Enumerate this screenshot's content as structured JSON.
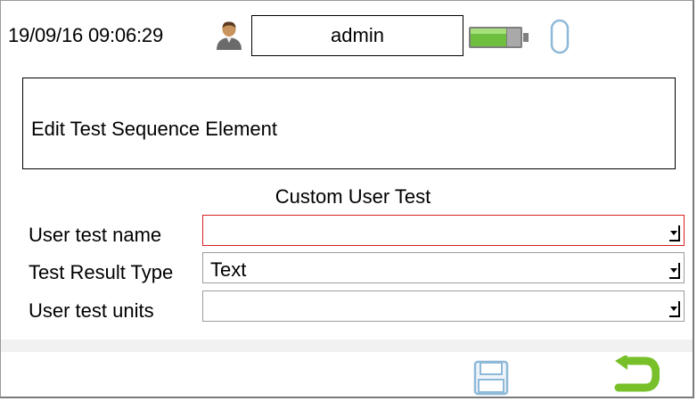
{
  "status_bar": {
    "datetime": "19/09/16 09:06:29",
    "user": "admin",
    "icons": [
      "user-icon",
      "battery-icon",
      "usb-icon"
    ]
  },
  "header": {
    "title": "Edit Test Sequence Element"
  },
  "form": {
    "section_title": "Custom User Test",
    "fields": [
      {
        "label": "User test name",
        "value": "",
        "error": true
      },
      {
        "label": "Test Result Type",
        "value": "Text",
        "error": false
      },
      {
        "label": "User test units",
        "value": "",
        "error": false
      }
    ]
  },
  "footer": {
    "icons": [
      "save-icon",
      "back-arrow-icon"
    ]
  },
  "colors": {
    "error_border": "#d82020",
    "battery_fill": "#6fbf3f",
    "back_arrow": "#77c02a",
    "save_icon": "#8fb9d8"
  }
}
